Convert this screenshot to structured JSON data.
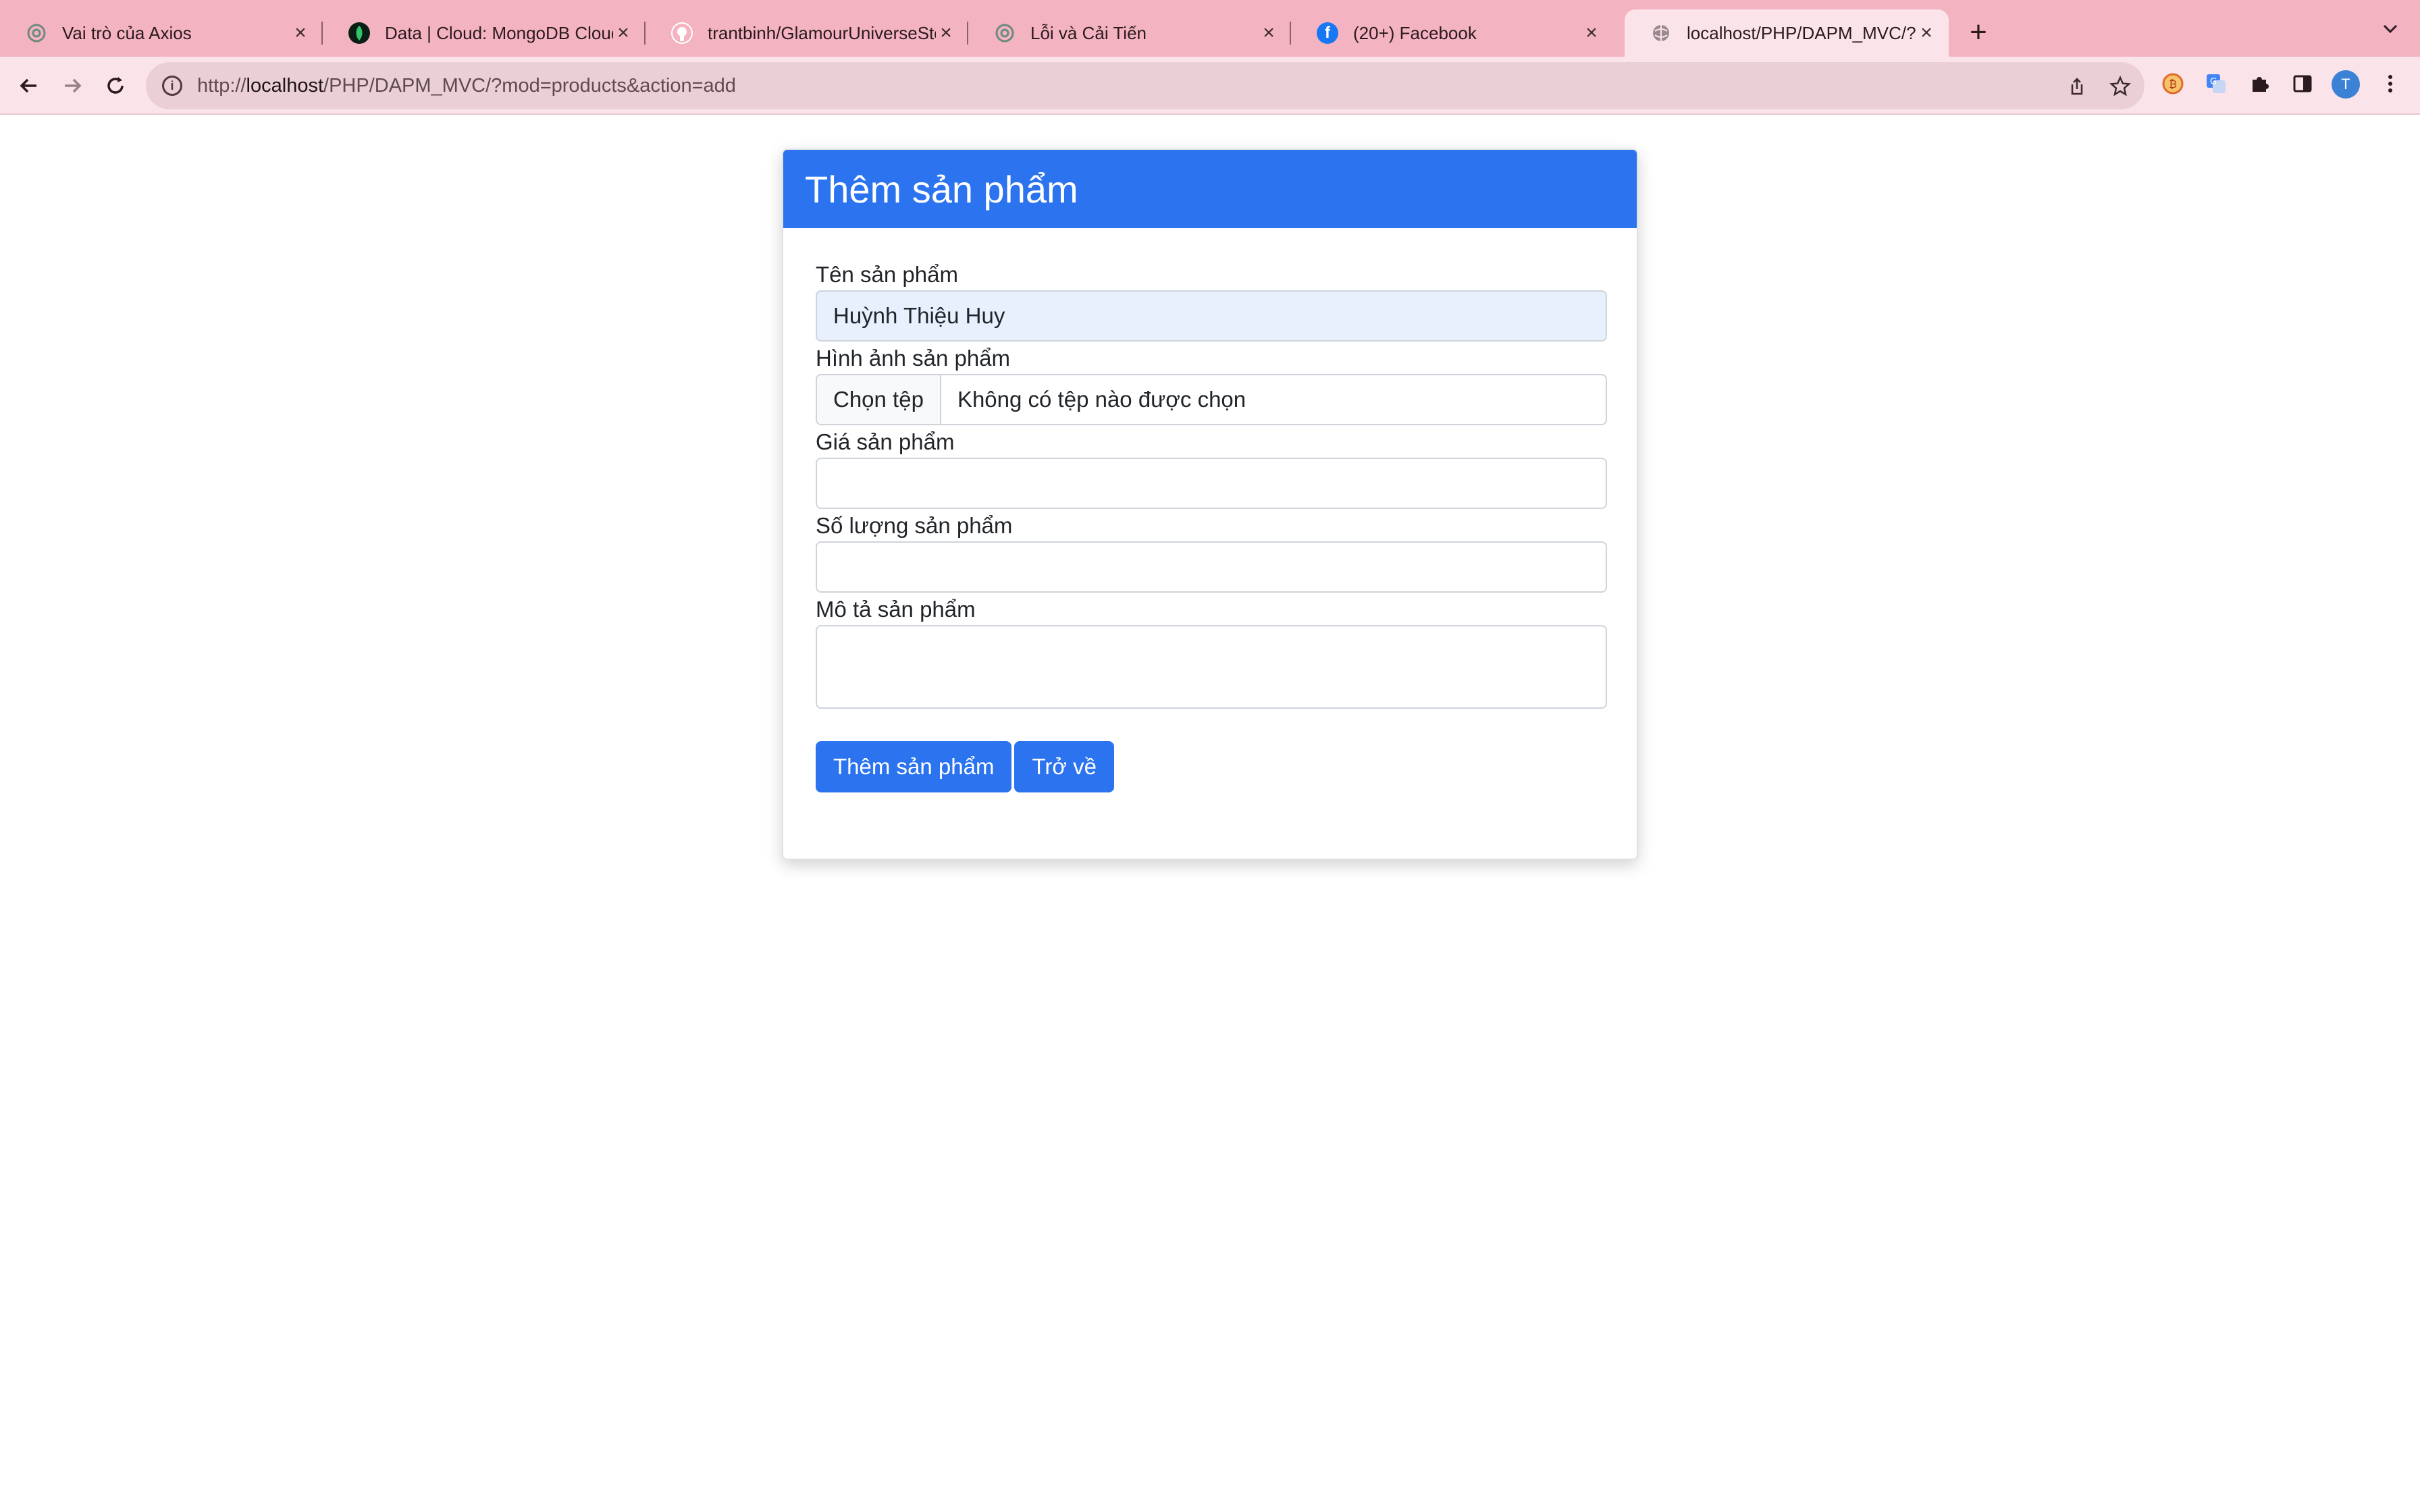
{
  "browser": {
    "tabs": [
      {
        "title": "Vai trò của Axios",
        "icon": "openai-icon"
      },
      {
        "title": "Data | Cloud: MongoDB Cloud",
        "icon": "mongodb-leaf-icon"
      },
      {
        "title": "trantbinh/GlamourUniverseSto",
        "icon": "github-icon"
      },
      {
        "title": "Lỗi và Cải Tiến",
        "icon": "openai-icon"
      },
      {
        "title": "(20+) Facebook",
        "icon": "facebook-icon"
      },
      {
        "title": "localhost/PHP/DAPM_MVC/?m",
        "icon": "globe-icon"
      }
    ],
    "active_tab_index": 5,
    "url_scheme": "http://",
    "url_host": "localhost",
    "url_path": "/PHP/DAPM_MVC/?mod=products&action=add",
    "profile_initial": "T",
    "colors": {
      "tabstrip": "#f4b3c0",
      "toolbar": "#fbe4e9"
    }
  },
  "page": {
    "header": "Thêm sản phẩm",
    "fields": {
      "name_label": "Tên sản phẩm",
      "name_value": "Huỳnh Thiệu Huy",
      "image_label": "Hình ảnh sản phẩm",
      "image_button": "Chọn tệp",
      "image_status": "Không có tệp nào được chọn",
      "price_label": "Giá sản phẩm",
      "price_value": "",
      "quantity_label": "Số lượng sản phẩm",
      "quantity_value": "",
      "description_label": "Mô tả sản phẩm",
      "description_value": ""
    },
    "buttons": {
      "submit": "Thêm sản phẩm",
      "back": "Trở về"
    },
    "colors": {
      "primary": "#2c73f0"
    }
  }
}
